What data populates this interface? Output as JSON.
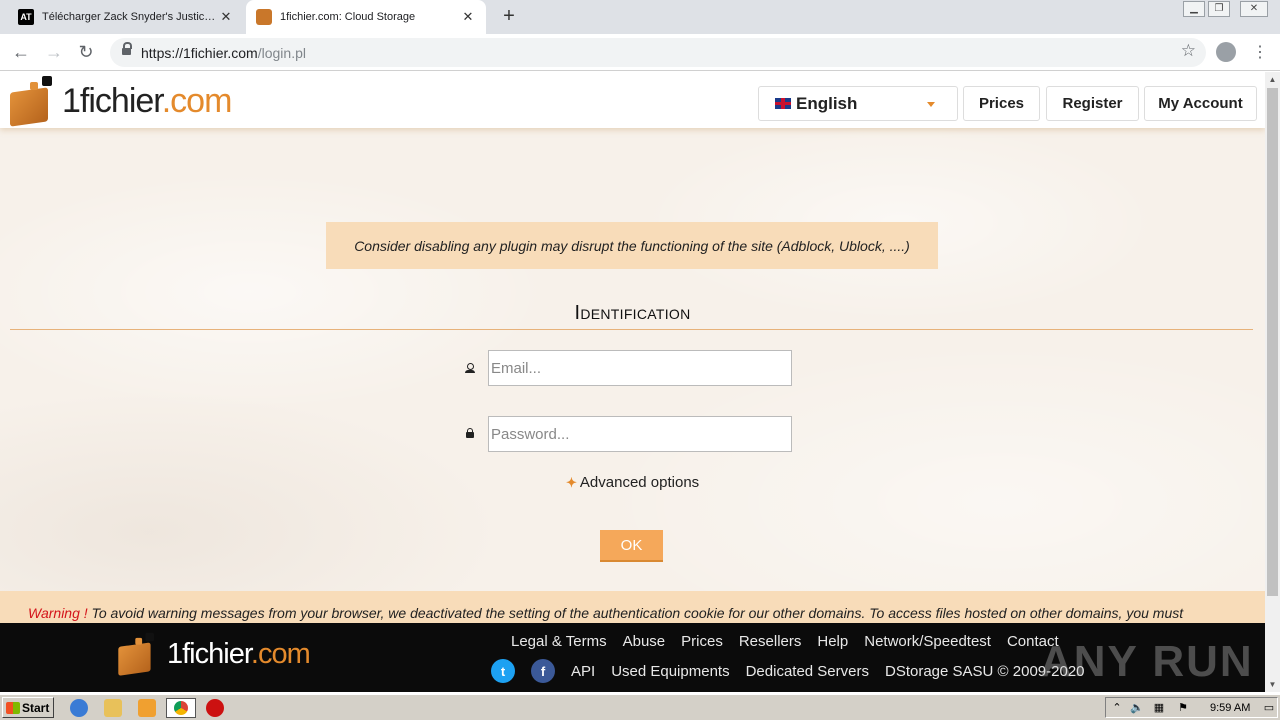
{
  "browser": {
    "tabs": [
      {
        "title": "Télécharger Zack Snyder's Justice League",
        "favicon": "AT",
        "active": false
      },
      {
        "title": "1fichier.com: Cloud Storage",
        "active": true
      }
    ],
    "url_host": "https://1fichier.com",
    "url_path": "/login.pl",
    "close_glyph": "✕",
    "new_tab_glyph": "+"
  },
  "header": {
    "logo_main": "1fichier",
    "logo_suffix": ".com",
    "language": "English",
    "buttons": [
      "Prices",
      "Register",
      "My Account"
    ]
  },
  "notice": "Consider disabling any plugin may disrupt the functioning of the site (Adblock, Ublock, ....)",
  "login": {
    "title": "Identification",
    "email_placeholder": "Email...",
    "password_placeholder": "Password...",
    "advanced": "Advanced options",
    "ok": "OK"
  },
  "warning": {
    "prefix": "Warning !",
    "text": " To avoid warning messages from your browser, we deactivated the setting of the authentication cookie for our other domains. To access files hosted on other domains, you must"
  },
  "footer": {
    "row1": [
      "Legal & Terms",
      "Abuse",
      "Prices",
      "Resellers",
      "Help",
      "Network/Speedtest",
      "Contact"
    ],
    "row2": [
      "API",
      "Used Equipments",
      "Dedicated Servers",
      "DStorage SASU © 2009-2020"
    ],
    "watermark": "ANY RUN"
  },
  "taskbar": {
    "start": "Start",
    "clock": "9:59 AM"
  },
  "colors": {
    "accent": "#e48a2c",
    "notice_bg": "#f8dcb9",
    "ok_bg": "#f5a85a"
  }
}
